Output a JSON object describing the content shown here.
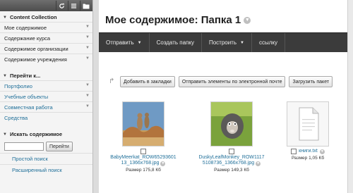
{
  "sidebar": {
    "section1_title": "Content Collection",
    "collection_items": [
      {
        "label": "Мое содержимое"
      },
      {
        "label": "Содержание курса"
      },
      {
        "label": "Содержимое организации"
      },
      {
        "label": "Содержимое учреждения"
      }
    ],
    "section2_title": "Перейти к...",
    "goto_items": [
      {
        "label": "Портфолио"
      },
      {
        "label": "Учебные объекты"
      },
      {
        "label": "Совместная работа"
      },
      {
        "label": "Средства"
      }
    ],
    "section3_title": "Искать содержимое",
    "search": {
      "value": "",
      "button": "Перейти"
    },
    "simple_search": "Простой поиск",
    "advanced_search": "Расширенный поиск"
  },
  "main": {
    "title": "Мое содержимое: Папка 1",
    "actionbar": [
      {
        "label": "Отправить"
      },
      {
        "label": "Создать папку"
      },
      {
        "label": "Построить"
      },
      {
        "label": "ссылку"
      }
    ],
    "toolbar": {
      "bookmark": "Добавить в закладки",
      "email": "Отправить элементы по электронной почте",
      "upload_package": "Загрузить пакет"
    },
    "files": [
      {
        "name": "BabyMeerkat_ROW6529360113_1366x768.jpg",
        "name_line1": "BabyMeerkat_ROW65293601",
        "name_line2": "13_1366x768.jpg",
        "size": "Размер 175,8 Кб"
      },
      {
        "name": "DuskyLeafMonkey_ROW1117510873 6_1366x768.jpg",
        "name_line1": "DuskyLeafMonkey_ROW1117",
        "name_line2": "5108736_1366x768.jpg",
        "size": "Размер 149,3 Кб"
      },
      {
        "name": "книги.txt",
        "name_line1": "книги.txt",
        "name_line2": "",
        "size": "Размер 1,05 Кб"
      }
    ]
  },
  "colors": {
    "link": "#1f6f99",
    "actionbar": "#3b3b3b"
  },
  "icons": [
    "refresh-icon",
    "list-icon",
    "folder-icon",
    "dropdown-chevron-icon",
    "text-file-icon",
    "checkbox-icon"
  ]
}
